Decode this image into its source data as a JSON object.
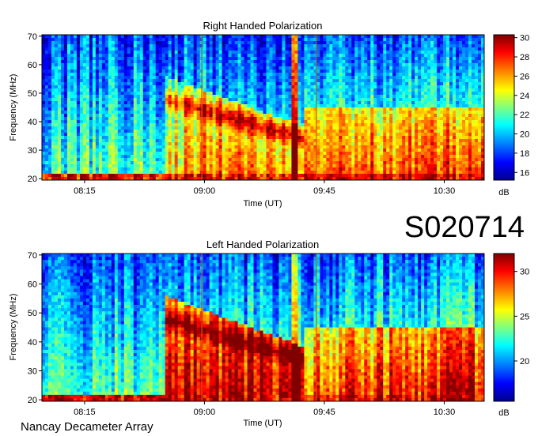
{
  "figure": {
    "observation_id": "S020714",
    "instrument": "Nancay Decameter Array"
  },
  "chart_data": [
    {
      "type": "heatmap",
      "title": "Right Handed Polarization",
      "xlabel": "Time (UT)",
      "ylabel": "Frequency (MHz)",
      "x_ticks": [
        "08:15",
        "09:00",
        "09:45",
        "10:30"
      ],
      "x_tick_minutes": [
        495,
        540,
        585,
        630
      ],
      "x_range_minutes": [
        479,
        645
      ],
      "y_ticks": [
        20,
        30,
        40,
        50,
        60,
        70
      ],
      "ylim": [
        19.5,
        70.5
      ],
      "colorbar": {
        "label": "dB",
        "min": 15.2,
        "max": 30.3,
        "ticks": [
          16,
          18,
          20,
          22,
          24,
          26,
          28,
          30
        ]
      },
      "colormap": [
        "#00008f",
        "#0000ff",
        "#0080ff",
        "#00ffff",
        "#80ff80",
        "#ffff00",
        "#ff8000",
        "#ff0000",
        "#800000"
      ],
      "burst_start_minute": 525,
      "burst_end_minute": 578,
      "vertical_markers_minutes": [
        539,
        582
      ],
      "spike_minute": 574
    },
    {
      "type": "heatmap",
      "title": "Left Handed Polarization",
      "xlabel": "Time (UT)",
      "ylabel": "Frequency (MHz)",
      "x_ticks": [
        "08:15",
        "09:00",
        "09:45",
        "10:30"
      ],
      "x_tick_minutes": [
        495,
        540,
        585,
        630
      ],
      "x_range_minutes": [
        479,
        645
      ],
      "y_ticks": [
        20,
        30,
        40,
        50,
        60,
        70
      ],
      "ylim": [
        19.5,
        70.5
      ],
      "colorbar": {
        "label": "dB",
        "min": 15.5,
        "max": 32.0,
        "ticks": [
          20,
          25,
          30
        ]
      },
      "colormap": [
        "#00008f",
        "#0000ff",
        "#0080ff",
        "#00ffff",
        "#80ff80",
        "#ffff00",
        "#ff8000",
        "#ff0000",
        "#800000"
      ],
      "burst_start_minute": 525,
      "burst_end_minute": 578,
      "vertical_markers_minutes": [
        539,
        582
      ],
      "spike_minute": 574
    }
  ]
}
